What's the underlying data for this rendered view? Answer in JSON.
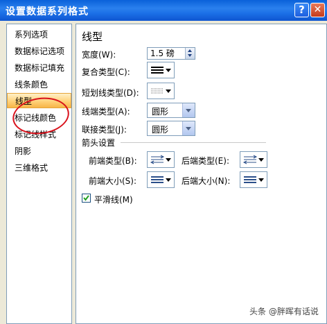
{
  "window": {
    "title": "设置数据系列格式",
    "help_glyph": "?",
    "close_glyph": "✕"
  },
  "nav": {
    "items": [
      {
        "label": "系列选项"
      },
      {
        "label": "数据标记选项"
      },
      {
        "label": "数据标记填充"
      },
      {
        "label": "线条颜色"
      },
      {
        "label": "线型",
        "selected": true
      },
      {
        "label": "标记线颜色"
      },
      {
        "label": "标记线样式"
      },
      {
        "label": "阴影"
      },
      {
        "label": "三维格式"
      }
    ],
    "highlight_color": "#d9111b"
  },
  "panel": {
    "title": "线型",
    "width_label": "宽度(W):",
    "width_value": "1.5 磅",
    "compound_label": "复合类型(C):",
    "dash_label": "短划线类型(D):",
    "cap_label": "线端类型(A):",
    "cap_value": "圆形",
    "join_label": "联接类型(J):",
    "join_value": "圆形",
    "arrow_section": "箭头设置",
    "begin_type_label": "前端类型(B):",
    "end_type_label": "后端类型(E):",
    "begin_size_label": "前端大小(S):",
    "end_size_label": "后端大小(N):",
    "smooth_label": "平滑线(M)",
    "smooth_checked": true
  },
  "watermark": "头条 @胖晖有话说"
}
